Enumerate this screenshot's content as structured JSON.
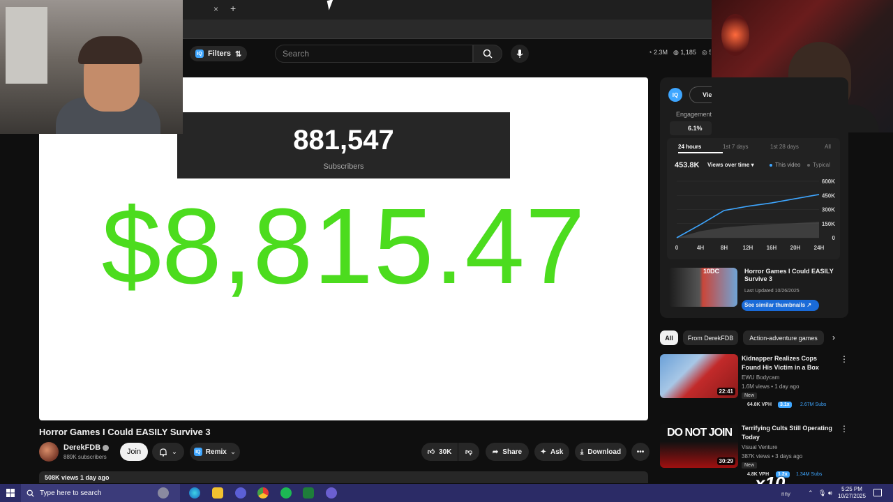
{
  "browser": {
    "tab_close": "×",
    "tab_add": "+"
  },
  "header": {
    "filters_label": "Filters",
    "filters_icon": "sliders-icon",
    "search_placeholder": "Search",
    "stats": [
      "2.3M",
      "1,185",
      "5("
    ]
  },
  "video": {
    "subscriber_count": "881,547",
    "subscriber_label": "Subscribers",
    "money": "$8,815.47",
    "title": "Horror Games I Could EASILY Survive 3",
    "channel_name": "DerekFDB",
    "channel_subs": "889K subscribers",
    "join_label": "Join",
    "remix_label": "Remix",
    "like_count": "30K",
    "share_label": "Share",
    "ask_label": "Ask",
    "download_label": "Download",
    "views_line": "508K views  1 day ago"
  },
  "panel": {
    "view_label": "View",
    "engagement_label": "Engagement",
    "engagement_value": "6.1%",
    "time_tabs": [
      "24 hours",
      "1st 7 days",
      "1st 28 days",
      "All"
    ],
    "views_total": "453.8K",
    "metric_label": "Views over time",
    "legend_this": "This video",
    "legend_typical": "Typical",
    "suggested_title": "Horror Games I Could EASILY Survive 3",
    "last_updated": "Last Updated 10/26/2025",
    "similar_button": "See similar thumbnails",
    "thumb_text": "10DC"
  },
  "chart_data": {
    "type": "area",
    "x": [
      "0",
      "4H",
      "8H",
      "12H",
      "16H",
      "20H",
      "24H"
    ],
    "y_ticks": [
      "600K",
      "450K",
      "300K",
      "150K",
      "0"
    ],
    "ylim": [
      0,
      600000
    ],
    "series": [
      {
        "name": "This video",
        "values": [
          0,
          140000,
          290000,
          335000,
          370000,
          415000,
          460000
        ]
      },
      {
        "name": "Typical",
        "values": [
          0,
          70000,
          110000,
          130000,
          145000,
          155000,
          170000
        ]
      }
    ],
    "colors": {
      "this": "#3ea6ff",
      "typical": "#555555"
    }
  },
  "chips": [
    "All",
    "From DerekFDB",
    "Action-adventure games"
  ],
  "related": [
    {
      "title": "Kidnapper Realizes Cops Found His Victim in a Box",
      "channel": "EWU Bodycam",
      "meta": "1.6M views • 1 day ago",
      "new": "New",
      "vph": "64.8K VPH",
      "badge": "3.1x",
      "subs": "2.67M Subs",
      "duration": "22:41"
    },
    {
      "title": "Terrifying Cults Still Operating Today",
      "channel": "Visual Venture",
      "meta": "387K views • 3 days ago",
      "new": "New",
      "vph": "4.8K VPH",
      "badge": "1.2x",
      "subs": "1.34M Subs",
      "duration": "30:29",
      "thumb_text": "DO NOT JOIN"
    }
  ],
  "overlay": {
    "multiplier": "x10"
  },
  "taskbar": {
    "search_placeholder": "Type here to search",
    "tray_user": "nny",
    "time": "5:25 PM",
    "date": "10/27/2025"
  }
}
